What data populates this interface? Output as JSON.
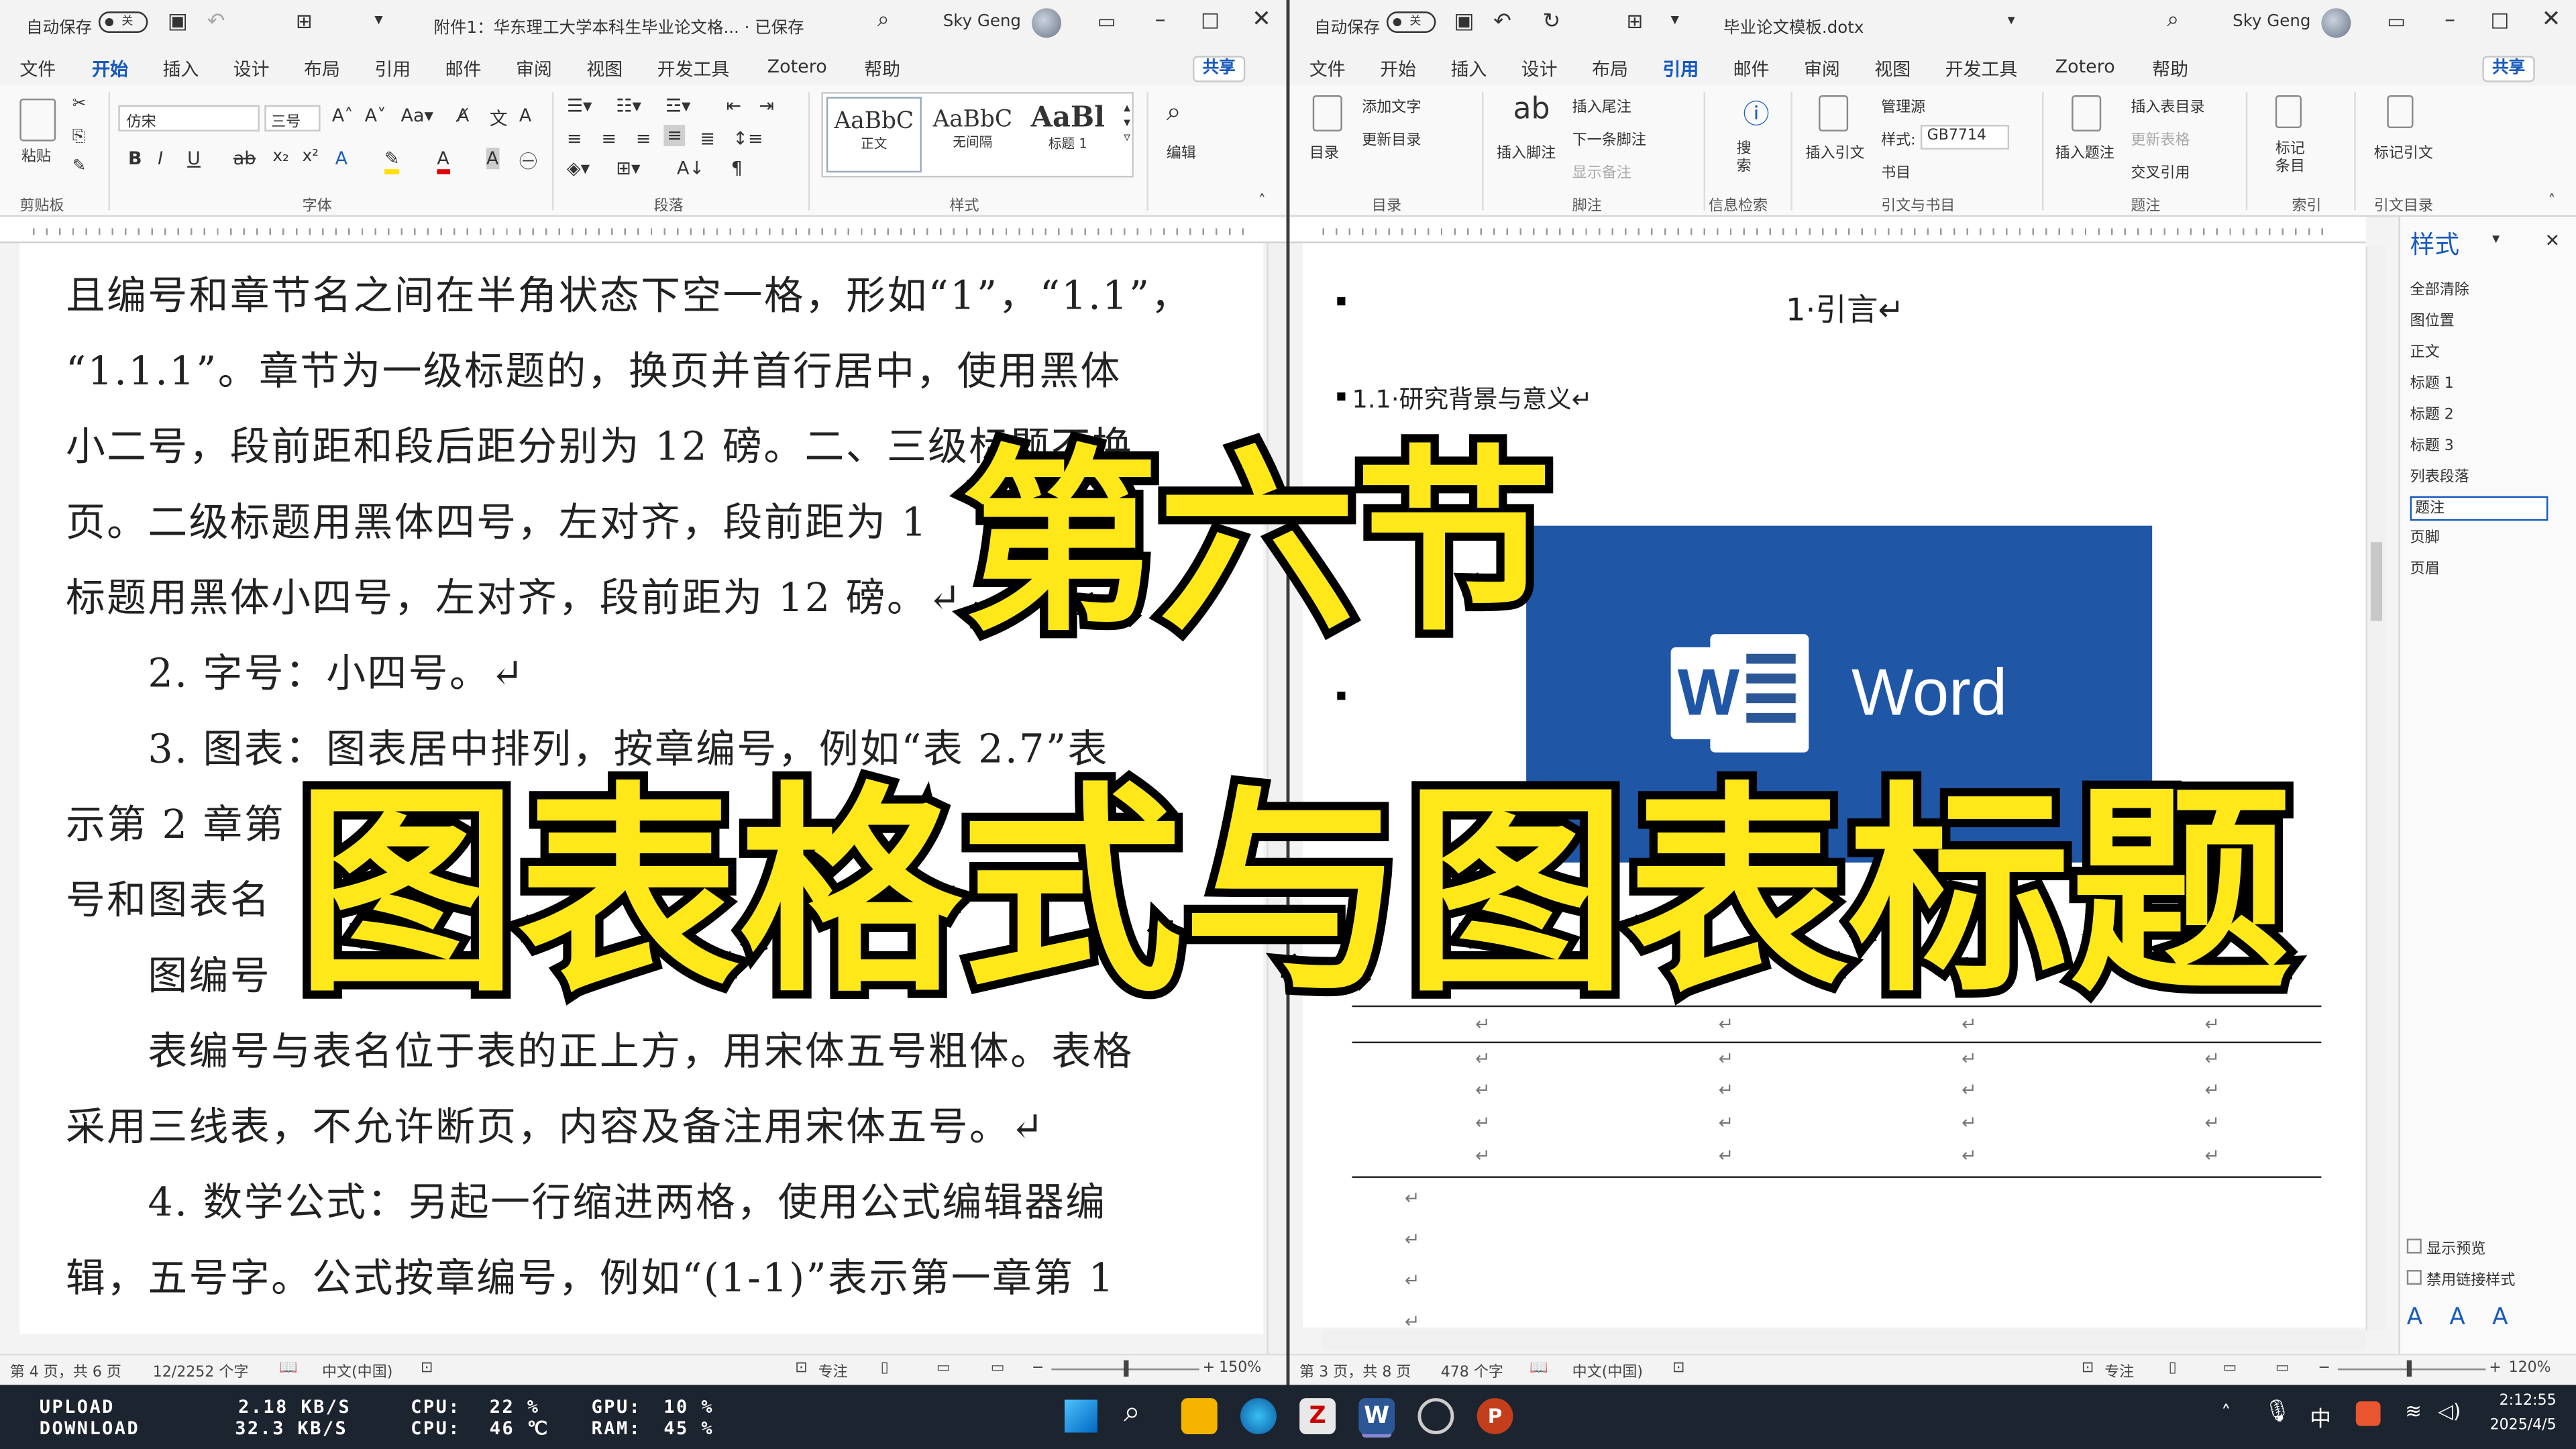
{
  "left": {
    "autosave": "自动保存",
    "toggle": "关",
    "title": "附件1：华东理工大学本科生毕业论文格... · 已保存",
    "user": "Sky Geng",
    "tabs": [
      "文件",
      "开始",
      "插入",
      "设计",
      "布局",
      "引用",
      "邮件",
      "审阅",
      "视图",
      "开发工具",
      "Zotero",
      "帮助"
    ],
    "share": "共享",
    "font_name": "仿宋",
    "font_size": "三号",
    "paste": "粘贴",
    "style_samples": [
      {
        "sample": "AaBbC",
        "label": "正文"
      },
      {
        "sample": "AaBbC",
        "label": "无间隔"
      },
      {
        "sample": "AaBl",
        "label": "标题 1"
      }
    ],
    "edit": "编辑",
    "groups": [
      "剪贴板",
      "字体",
      "段落",
      "样式"
    ],
    "doc_lines": [
      "且编号和章节名之间在半角状态下空一格，形如“1”，“1.1”，",
      "“1.1.1”。章节为一级标题的，换页并首行居中，使用黑体",
      "小二号，段前距和段后距分别为 12 磅。二、三级标题不换",
      "页。二级标题用黑体四号，左对齐，段前距为 1",
      "标题用黑体小四号，左对齐，段前距为 12 磅。↵",
      "　　2. 字号：小四号。↵",
      "　　3. 图表：图表居中排列，按章编号，例如“表 2.7”表",
      "示第 2 章第",
      "号和图表名",
      "　　图编号",
      "　　表编号与表名位于表的正上方，用宋体五号粗体。表格",
      "采用三线表，不允许断页，内容及备注用宋体五号。↵",
      "　　4. 数学公式：另起一行缩进两格，使用公式编辑器编",
      "辑，五号字。公式按章编号，例如“(1-1)”表示第一章第 1"
    ],
    "status_page": "第 4 页，共 6 页",
    "status_words": "12/2252 个字",
    "status_lang": "中文(中国)",
    "status_focus": "专注",
    "zoom": "150%"
  },
  "right": {
    "autosave": "自动保存",
    "toggle": "关",
    "title": "毕业论文模板.dotx",
    "user": "Sky Geng",
    "tabs": [
      "文件",
      "开始",
      "插入",
      "设计",
      "布局",
      "引用",
      "邮件",
      "审阅",
      "视图",
      "开发工具",
      "Zotero",
      "帮助"
    ],
    "share": "共享",
    "ribbon": {
      "toc": "目录",
      "add_text": "添加文字",
      "update_toc": "更新目录",
      "insert_footnote": "插入脚注",
      "insert_endnote": "插入尾注",
      "next_footnote": "下一条脚注",
      "show_notes": "显示备注",
      "search": "搜索",
      "insert_citation": "插入引文",
      "manage_sources": "管理源",
      "style_label": "样式:",
      "style_value": "GB7714",
      "bibliography": "书目",
      "insert_caption": "插入题注",
      "insert_table_of_figures": "插入表目录",
      "update_table": "更新表格",
      "cross_reference": "交叉引用",
      "mark_entry": "标记条目",
      "mark_citation": "标记引文"
    },
    "groups": [
      "目录",
      "脚注",
      "信息检索",
      "引文与书目",
      "题注",
      "索引",
      "引文目录"
    ],
    "heading1": "1·引言↵",
    "heading2": "1.1·研究背景与意义↵",
    "word_logo_text": "Word",
    "styles_title": "样式",
    "styles": [
      "全部清除",
      "图位置",
      "正文",
      "标题 1",
      "标题 2",
      "标题 3",
      "列表段落",
      "题注",
      "页脚",
      "页眉"
    ],
    "show_preview": "显示预览",
    "disable_linked": "禁用链接样式",
    "status_page": "第 3 页，共 8 页",
    "status_words": "478 个字",
    "status_lang": "中文(中国)",
    "status_focus": "专注",
    "zoom": "120%"
  },
  "overlay": {
    "line1": "第六节",
    "line2": "图表格式与图表标题"
  },
  "taskbar": {
    "upload_label": "UPLOAD",
    "download_label": "DOWNLOAD",
    "upload_speed": "2.18 KB/S",
    "download_speed": "32.3 KB/S",
    "cpu_label": "CPU:",
    "cpu_usage": "22 %",
    "cpu_temp": "46 ℃",
    "gpu_label": "GPU:",
    "gpu_usage": "10 %",
    "ram_label": "RAM:",
    "ram_usage": "45 %",
    "ime": "中",
    "time": "2:12:55",
    "date": "2025/4/5"
  },
  "colors": {
    "accent": "#185abd",
    "overlay_fill": "#ffe81a",
    "word_blue": "#1f57a6",
    "taskbar": "#1c2430"
  }
}
